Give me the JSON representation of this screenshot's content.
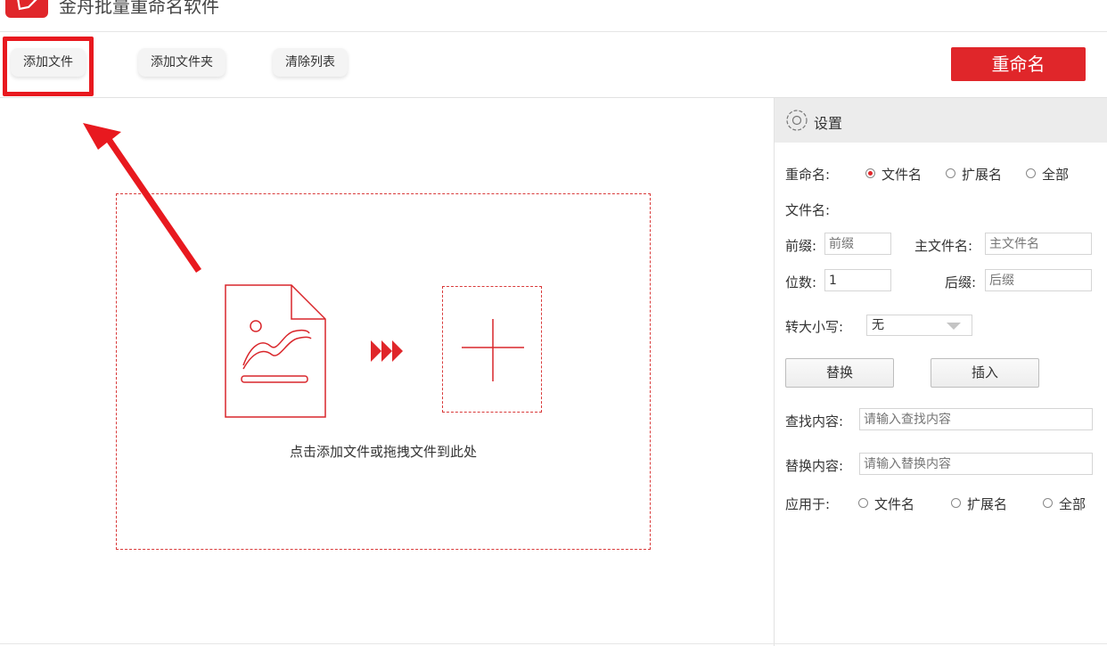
{
  "app": {
    "title": "金舟批量重命名软件"
  },
  "toolbar": {
    "add_file": "添加文件",
    "add_folder": "添加文件夹",
    "clear_list": "清除列表",
    "rename": "重命名"
  },
  "dropzone": {
    "hint": "点击添加文件或拖拽文件到此处"
  },
  "settings": {
    "title": "设置",
    "rename_label": "重命名:",
    "rename_options": [
      "文件名",
      "扩展名",
      "全部"
    ],
    "rename_selected": "文件名",
    "filename_label": "文件名:",
    "prefix_label": "前缀:",
    "prefix_placeholder": "前缀",
    "main_name_label": "主文件名:",
    "main_name_placeholder": "主文件名",
    "digits_label": "位数:",
    "digits_value": "1",
    "suffix_label": "后缀:",
    "suffix_placeholder": "后缀",
    "case_label": "转大小写:",
    "case_value": "无",
    "replace_button": "替换",
    "insert_button": "插入",
    "find_label": "查找内容:",
    "find_placeholder": "请输入查找内容",
    "replace_label": "替换内容:",
    "replace_placeholder": "请输入替换内容",
    "apply_label": "应用于:",
    "apply_options": [
      "文件名",
      "扩展名",
      "全部"
    ]
  },
  "colors": {
    "accent": "#e0262a",
    "annotation": "#e8191f"
  },
  "icons": [
    "app-logo-icon",
    "document-image-icon",
    "triple-arrow-icon",
    "plus-icon",
    "gear-icon",
    "annotation-arrow-icon"
  ]
}
